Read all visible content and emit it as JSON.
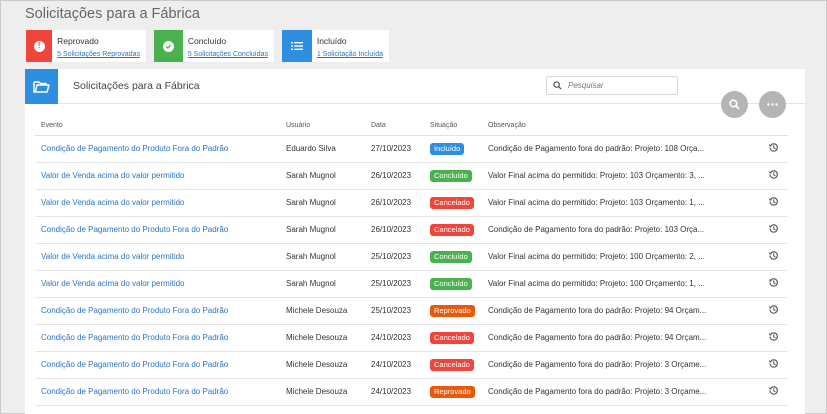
{
  "page": {
    "title": "Solicitações para a Fábrica"
  },
  "status_cards": [
    {
      "label": "Reprovado",
      "link": "5 Solicitações Reprovadas",
      "color": "#f0453a",
      "icon": "exclamation-icon"
    },
    {
      "label": "Concluído",
      "link": "5 Solicitações Concluídas",
      "color": "#49b14d",
      "icon": "check-icon"
    },
    {
      "label": "Incluído",
      "link": "1 Solicitação Incluída",
      "color": "#2f8ee0",
      "icon": "list-icon"
    }
  ],
  "panel": {
    "title": "Solicitações para a Fábrica",
    "search_placeholder": "Pesquisar"
  },
  "table": {
    "headers": [
      "Evento",
      "Usuário",
      "Data",
      "Situação",
      "Observação"
    ],
    "rows": [
      {
        "evento": "Condição de Pagamento do Produto Fora do Padrão",
        "usuario": "Eduardo Silva",
        "data": "27/10/2023",
        "situacao": "Incluído",
        "observacao": "Condição de Pagamento fora do padrão: Projeto: 108 Orça..."
      },
      {
        "evento": "Valor de Venda acima do valor permitido",
        "usuario": "Sarah Mugnol",
        "data": "26/10/2023",
        "situacao": "Concluído",
        "observacao": "Valor Final acima do permitido: Projeto: 103 Orçamento: 3, ..."
      },
      {
        "evento": "Valor de Venda acima do valor permitido",
        "usuario": "Sarah Mugnol",
        "data": "26/10/2023",
        "situacao": "Cancelado",
        "observacao": "Valor Final acima do permitido: Projeto: 103 Orçamento: 1, ..."
      },
      {
        "evento": "Condição de Pagamento do Produto Fora do Padrão",
        "usuario": "Sarah Mugnol",
        "data": "26/10/2023",
        "situacao": "Cancelado",
        "observacao": "Condição de Pagamento fora do padrão: Projeto: 103 Orça..."
      },
      {
        "evento": "Valor de Venda acima do valor permitido",
        "usuario": "Sarah Mugnol",
        "data": "25/10/2023",
        "situacao": "Concluído",
        "observacao": "Valor Final acima do permitido: Projeto: 100 Orçamento: 2, ..."
      },
      {
        "evento": "Valor de Venda acima do valor permitido",
        "usuario": "Sarah Mugnol",
        "data": "25/10/2023",
        "situacao": "Concluído",
        "observacao": "Valor Final acima do permitido: Projeto: 100 Orçamento: 1, ..."
      },
      {
        "evento": "Condição de Pagamento do Produto Fora do Padrão",
        "usuario": "Michele Desouza",
        "data": "25/10/2023",
        "situacao": "Reprovado",
        "observacao": "Condição de Pagamento fora do padrão: Projeto: 94 Orçam..."
      },
      {
        "evento": "Condição de Pagamento do Produto Fora do Padrão",
        "usuario": "Michele Desouza",
        "data": "24/10/2023",
        "situacao": "Cancelado",
        "observacao": "Condição de Pagamento fora do padrão: Projeto: 94 Orçam..."
      },
      {
        "evento": "Condição de Pagamento do Produto Fora do Padrão",
        "usuario": "Michele Desouza",
        "data": "24/10/2023",
        "situacao": "Cancelado",
        "observacao": "Condição de Pagamento fora do padrão: Projeto: 3 Orçame..."
      },
      {
        "evento": "Condição de Pagamento do Produto Fora do Padrão",
        "usuario": "Michele Desouza",
        "data": "24/10/2023",
        "situacao": "Reprovado",
        "observacao": "Condição de Pagamento fora do padrão: Projeto: 3 Orçame..."
      }
    ]
  },
  "badge_colors": {
    "Incluído": "#2f8ee0",
    "Concluído": "#49b14d",
    "Cancelado": "#f0453a",
    "Reprovado": "#e8590c"
  },
  "icons": {
    "row_action": "history-icon",
    "search": "search-icon",
    "more": "more-icon",
    "panel": "folder-icon"
  }
}
